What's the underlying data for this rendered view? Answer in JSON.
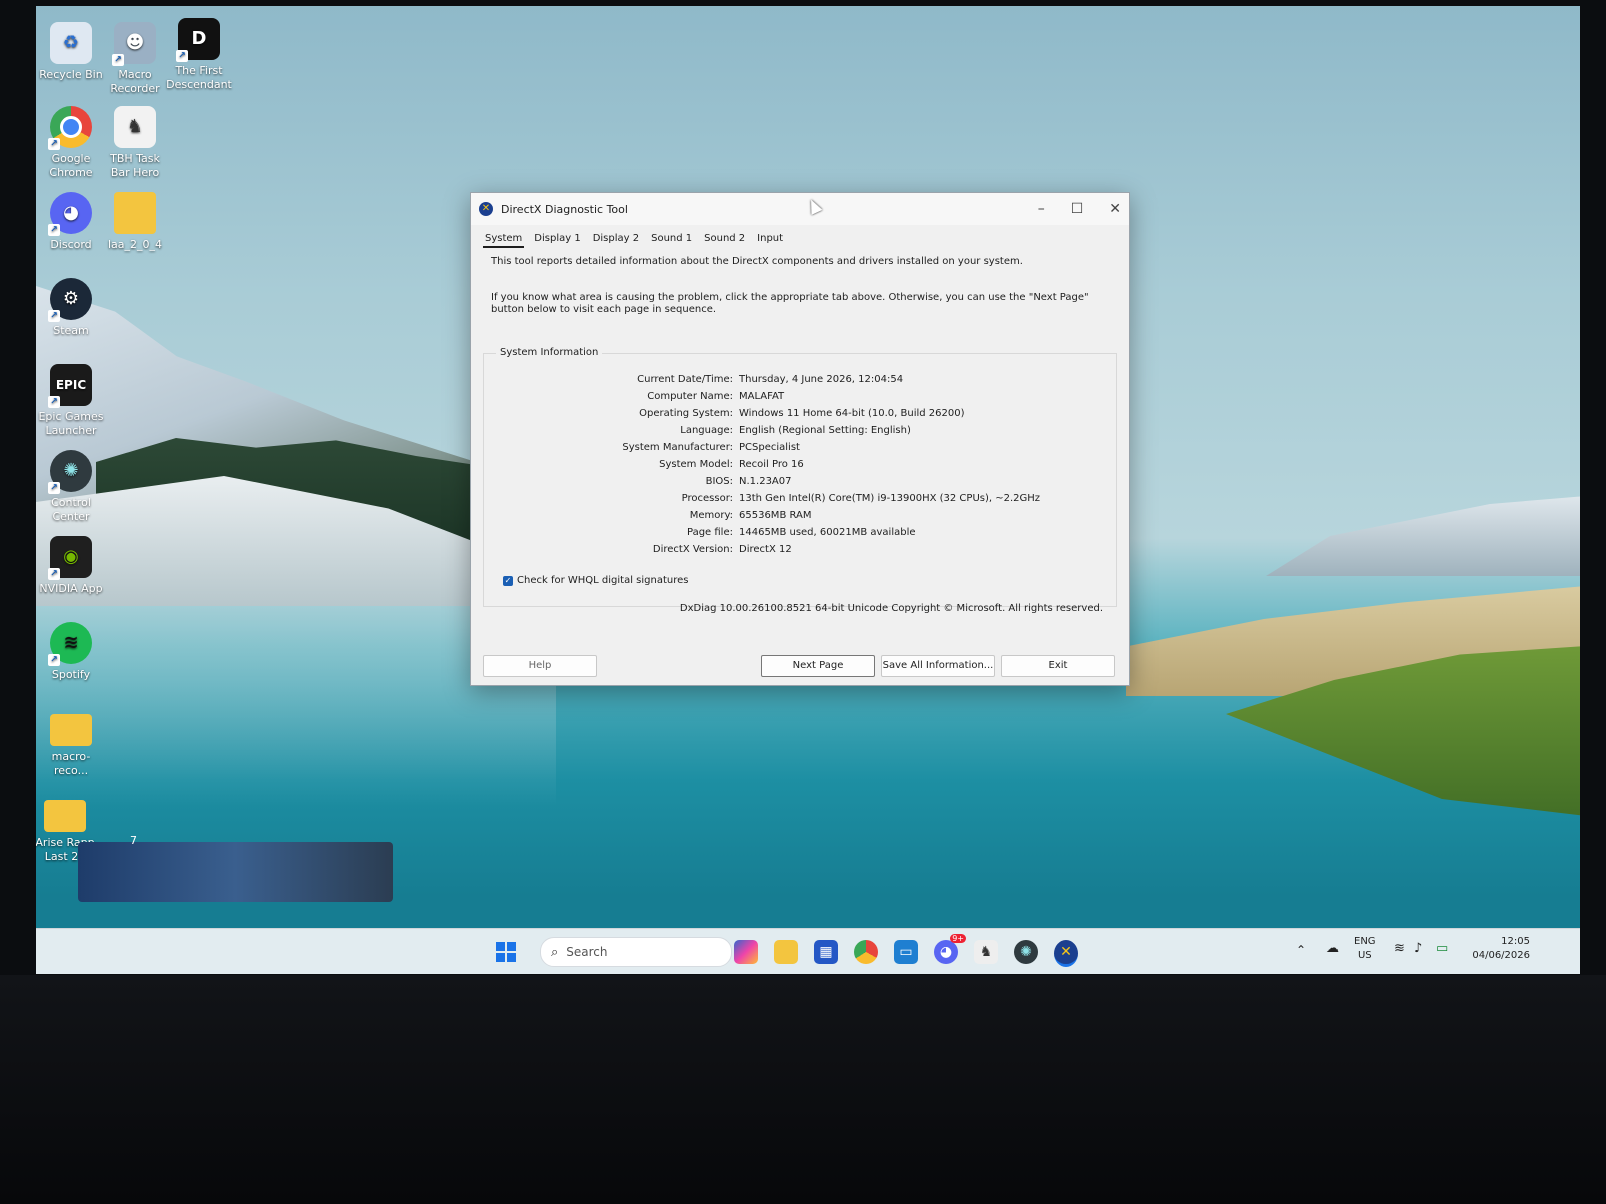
{
  "desktop_icons": [
    {
      "label": "Recycle Bin",
      "icon": "recycle-bin-icon",
      "color": "#dfe8f2"
    },
    {
      "label": "Macro Recorder",
      "icon": "macro-recorder-icon",
      "color": "#9ab0c4"
    },
    {
      "label": "The First Descendant",
      "icon": "the-first-descendant-icon",
      "color": "#111111"
    },
    {
      "label": "Google Chrome",
      "icon": "chrome-icon",
      "color": "#e8453c"
    },
    {
      "label": "TBH Task Bar Hero",
      "icon": "task-bar-hero-icon",
      "color": "#f2f2f2"
    },
    {
      "label": "Discord",
      "icon": "discord-icon",
      "color": "#5865f2"
    },
    {
      "label": "laa_2_0_4",
      "icon": "folder-icon",
      "color": "#f3c53f"
    },
    {
      "label": "Steam",
      "icon": "steam-icon",
      "color": "#1b2838"
    },
    {
      "label": "Epic Games Launcher",
      "icon": "epic-games-icon",
      "color": "#1a1a1a"
    },
    {
      "label": "Control Center",
      "icon": "control-center-icon",
      "color": "#2f3a3f"
    },
    {
      "label": "NVIDIA App",
      "icon": "nvidia-icon",
      "color": "#1f1f1f"
    },
    {
      "label": "Spotify",
      "icon": "spotify-icon",
      "color": "#1db954"
    },
    {
      "label": "macro-reco...",
      "icon": "folder-icon",
      "color": "#f3c53f"
    },
    {
      "label": "Arise Rapp Last 20",
      "icon": "folder-icon",
      "color": "#f3c53f"
    }
  ],
  "window": {
    "title": "DirectX Diagnostic Tool",
    "tabs": [
      "System",
      "Display 1",
      "Display 2",
      "Sound 1",
      "Sound 2",
      "Input"
    ],
    "active_tab": "System",
    "intro1": "This tool reports detailed information about the DirectX components and drivers installed on your system.",
    "intro2": "If you know what area is causing the problem, click the appropriate tab above.  Otherwise, you can use the \"Next Page\" button below to visit each page in sequence.",
    "group_title": "System Information",
    "info": [
      {
        "key": "Current Date/Time:",
        "value": "Thursday, 4 June 2026, 12:04:54"
      },
      {
        "key": "Computer Name:",
        "value": "MALAFAT"
      },
      {
        "key": "Operating System:",
        "value": "Windows 11 Home 64-bit (10.0, Build 26200)"
      },
      {
        "key": "Language:",
        "value": "English (Regional Setting: English)"
      },
      {
        "key": "System Manufacturer:",
        "value": "PCSpecialist"
      },
      {
        "key": "System Model:",
        "value": "Recoil Pro 16"
      },
      {
        "key": "BIOS:",
        "value": "N.1.23A07"
      },
      {
        "key": "Processor:",
        "value": "13th Gen Intel(R) Core(TM) i9-13900HX (32 CPUs), ~2.2GHz"
      },
      {
        "key": "Memory:",
        "value": "65536MB RAM"
      },
      {
        "key": "Page file:",
        "value": "14465MB used, 60021MB available"
      },
      {
        "key": "DirectX Version:",
        "value": "DirectX 12"
      }
    ],
    "whql_label": "Check for WHQL digital signatures",
    "whql_checked": true,
    "version_line": "DxDiag 10.00.26100.8521 64-bit Unicode  Copyright © Microsoft. All rights reserved.",
    "buttons": {
      "help": "Help",
      "next": "Next Page",
      "save": "Save All Information...",
      "exit": "Exit"
    }
  },
  "taskbar": {
    "search_placeholder": "Search",
    "apps": [
      "copilot-icon",
      "file-explorer-icon",
      "microsoft-store-icon",
      "chrome-icon",
      "remote-desktop-icon",
      "discord-icon",
      "task-bar-hero-icon",
      "control-center-icon",
      "directx-icon"
    ],
    "discord_badge": "9+",
    "lang_top": "ENG",
    "lang_bottom": "US",
    "time": "12:05",
    "date": "04/06/2026"
  },
  "game_overlay_level": "7"
}
